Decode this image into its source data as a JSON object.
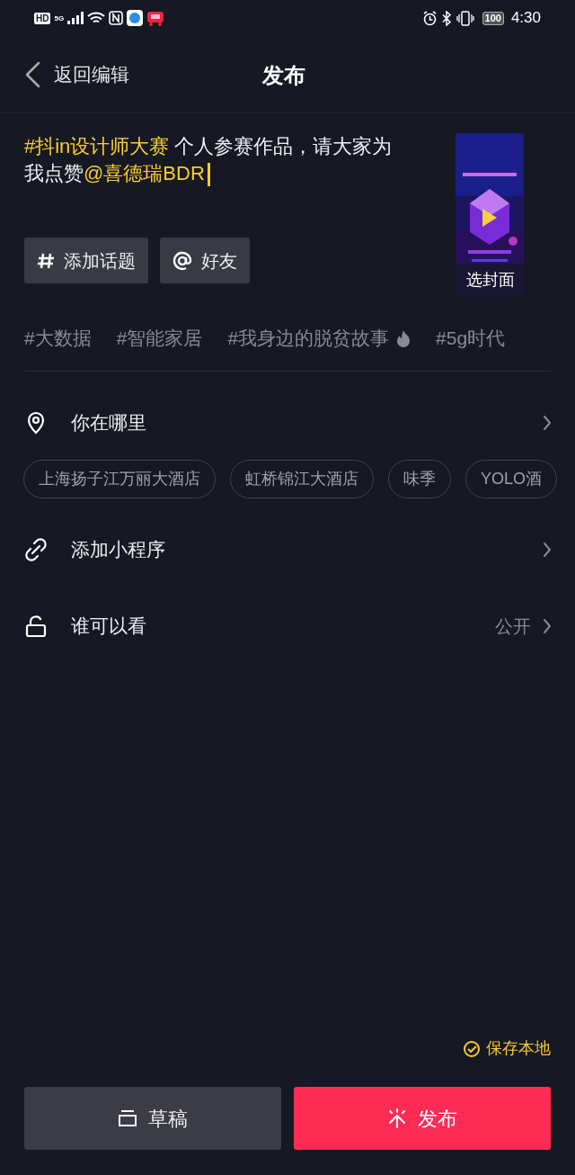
{
  "status_bar": {
    "left_badges": [
      "HD",
      "5G"
    ],
    "battery": "100",
    "time": "4:30"
  },
  "header": {
    "back": "返回编辑",
    "title": "发布"
  },
  "caption": [
    {
      "kind": "topic",
      "text": "#抖in设计师大赛"
    },
    {
      "kind": "plain",
      "text": " 个人参赛作品，请大家为我点赞"
    },
    {
      "kind": "mention",
      "text": "@喜德瑞BDR"
    }
  ],
  "cover": {
    "label": "选封面"
  },
  "tool_buttons": [
    {
      "kind": "hashtag",
      "label": "添加话题"
    },
    {
      "kind": "mention",
      "label": "好友"
    }
  ],
  "suggested_topics": [
    {
      "text": "#大数据",
      "hot": false
    },
    {
      "text": "#智能家居",
      "hot": false
    },
    {
      "text": "#我身边的脱贫故事",
      "hot": true
    },
    {
      "text": "#5g时代",
      "hot": false
    }
  ],
  "location": {
    "label": "你在哪里",
    "chips": [
      "上海扬子江万丽大酒店",
      "虹桥锦江大酒店",
      "味季",
      "YOLO酒"
    ]
  },
  "rows": [
    {
      "kind": "miniapp",
      "label": "添加小程序"
    },
    {
      "kind": "privacy",
      "label": "谁可以看",
      "value": "公开"
    }
  ],
  "save_local": {
    "label": "保存本地",
    "checked": true
  },
  "actions": [
    {
      "kind": "draft",
      "label": "草稿"
    },
    {
      "kind": "publish",
      "label": "发布"
    }
  ]
}
